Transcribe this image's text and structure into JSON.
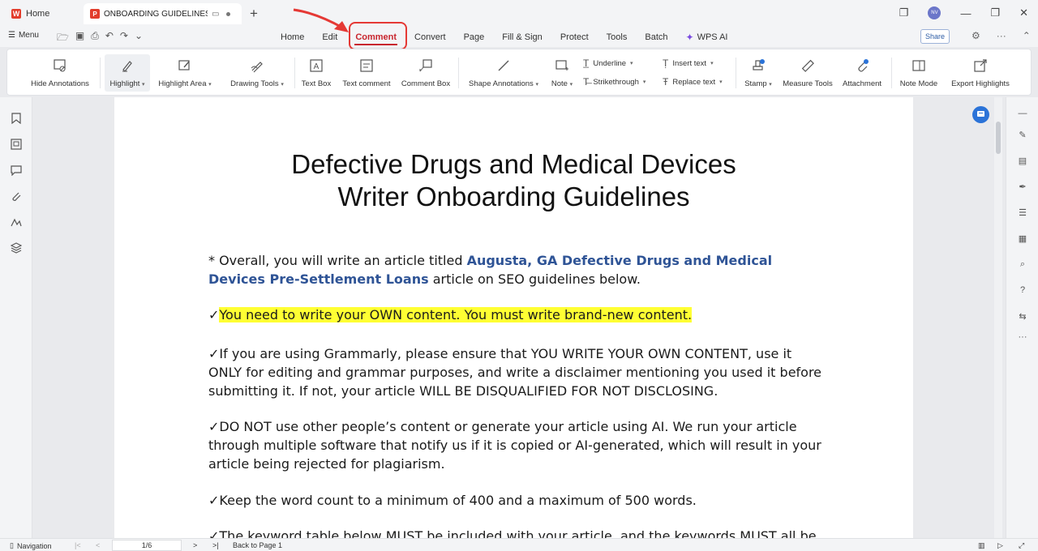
{
  "titlebar": {
    "home_tab": "Home",
    "doc_tab": "ONBOARDING GUIDELINES PD",
    "avatar": "NV"
  },
  "menubar": {
    "menu_label": "Menu",
    "tabs": [
      "Home",
      "Edit",
      "Comment",
      "Convert",
      "Page",
      "Fill & Sign",
      "Protect",
      "Tools",
      "Batch"
    ],
    "active_tab": "Comment",
    "wps_ai": "WPS AI",
    "share": "Share"
  },
  "ribbon": {
    "hide_annotations": "Hide Annotations",
    "highlight": "Highlight",
    "highlight_area": "Highlight Area",
    "drawing_tools": "Drawing Tools",
    "text_box": "Text Box",
    "text_comment": "Text comment",
    "comment_box": "Comment Box",
    "shape_annotations": "Shape Annotations",
    "note": "Note",
    "underline": "Underline",
    "strikethrough": "Strikethrough",
    "insert_text": "Insert text",
    "replace_text": "Replace text",
    "stamp": "Stamp",
    "measure_tools": "Measure Tools",
    "attachment": "Attachment",
    "note_mode": "Note Mode",
    "export_highlights": "Export Highlights"
  },
  "document": {
    "title_line1": "Defective Drugs and Medical Devices",
    "title_line2": "Writer Onboarding Guidelines",
    "p1_prefix": "* Overall, you will write an article titled ",
    "p1_link": "Augusta, GA Defective Drugs and Medical Devices Pre-Settlement Loans",
    "p1_suffix": " article on SEO guidelines below.",
    "p2_check": "✓",
    "p2": "You need to write your OWN content. You must write brand-new content.",
    "p3": "✓If you are using Grammarly, please ensure that YOU WRITE YOUR OWN CONTENT, use it ONLY for editing and grammar purposes, and write a disclaimer mentioning you used it before submitting it. If not, your article WILL BE DISQUALIFIED FOR NOT DISCLOSING.",
    "p4": "✓DO NOT use other people’s content or generate your article using AI. We run your article through multiple software that notify us if it is copied or AI-generated, which will result in your article being rejected for plagiarism.",
    "p5": "✓Keep the word count to a minimum of 400 and a maximum of 500 words.",
    "p6": "✓The keyword table below MUST be included with your article, and the keywords MUST all be"
  },
  "statusbar": {
    "navigation": "Navigation",
    "page_indicator": "1/6",
    "back_to_page": "Back to Page 1"
  },
  "colors": {
    "accent": "#c8262e",
    "link": "#2f5496",
    "highlight": "#ffff33",
    "annotation_ring": "#e53935"
  }
}
